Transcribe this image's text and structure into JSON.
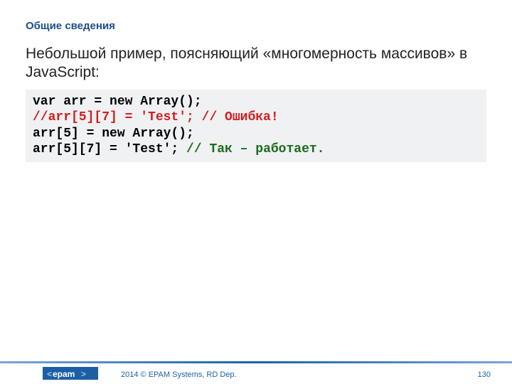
{
  "header": {
    "title": "Общие сведения"
  },
  "body": {
    "intro": "Небольшой пример, поясняющий «многомерность массивов» в JavaScript:"
  },
  "code": {
    "line1": "var arr = new Array();",
    "line2": "//arr[5][7] = 'Test'; // Ошибка!",
    "line3": "arr[5] = new Array();",
    "line4_code": "arr[5][7] = 'Test'; ",
    "line4_comment": "// Так – работает."
  },
  "footer": {
    "logo_text": "epam",
    "copyright": "2014 © EPAM Systems, RD Dep.",
    "page_number": "130"
  }
}
